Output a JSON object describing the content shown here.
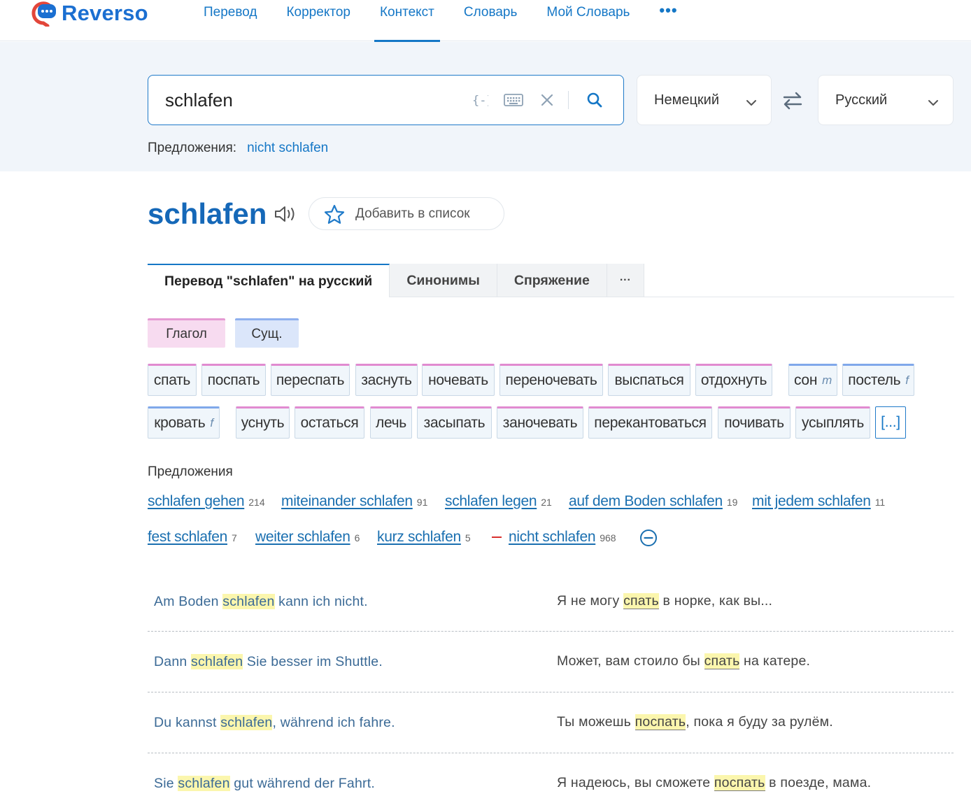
{
  "brand": {
    "name": "Reverso"
  },
  "nav": {
    "items": [
      {
        "label": "Перевод",
        "active": false
      },
      {
        "label": "Корректор",
        "active": false
      },
      {
        "label": "Контекст",
        "active": true
      },
      {
        "label": "Словарь",
        "active": false
      },
      {
        "label": "Мой Словарь",
        "active": false
      }
    ],
    "more": "•••"
  },
  "search": {
    "query": "schlafen",
    "source_lang": "Немецкий",
    "target_lang": "Русский",
    "suggestions_label": "Предложения:",
    "suggestion": "nicht schlafen"
  },
  "entry": {
    "headword": "schlafen",
    "add_to_list": "Добавить в список"
  },
  "tabs": [
    {
      "label": "Перевод \"schlafen\" на русский",
      "active": true
    },
    {
      "label": "Синонимы",
      "active": false
    },
    {
      "label": "Спряжение",
      "active": false
    },
    {
      "label": "···",
      "active": false
    }
  ],
  "pos": {
    "verb": "Глагол",
    "noun": "Сущ."
  },
  "translations": [
    {
      "text": "спать",
      "pos": "verb"
    },
    {
      "text": "поспать",
      "pos": "verb"
    },
    {
      "text": "переспать",
      "pos": "verb"
    },
    {
      "text": "заснуть",
      "pos": "verb"
    },
    {
      "text": "ночевать",
      "pos": "verb"
    },
    {
      "text": "переночевать",
      "pos": "verb"
    },
    {
      "text": "выспаться",
      "pos": "verb"
    },
    {
      "text": "отдохнуть",
      "pos": "verb"
    },
    {
      "text": "сон",
      "pos": "noun",
      "gender": "m"
    },
    {
      "text": "постель",
      "pos": "noun",
      "gender": "f"
    },
    {
      "text": "кровать",
      "pos": "noun",
      "gender": "f"
    },
    {
      "text": "уснуть",
      "pos": "verb"
    },
    {
      "text": "остаться",
      "pos": "verb"
    },
    {
      "text": "лечь",
      "pos": "verb"
    },
    {
      "text": "засыпать",
      "pos": "verb"
    },
    {
      "text": "заночевать",
      "pos": "verb"
    },
    {
      "text": "перекантоваться",
      "pos": "verb"
    },
    {
      "text": "почивать",
      "pos": "verb"
    },
    {
      "text": "усыплять",
      "pos": "verb"
    },
    {
      "text": "[...]",
      "pos": "more"
    }
  ],
  "phrases": {
    "title": "Предложения",
    "items": [
      {
        "text": "schlafen gehen",
        "count": "214"
      },
      {
        "text": "miteinander schlafen",
        "count": "91"
      },
      {
        "text": "schlafen legen",
        "count": "21"
      },
      {
        "text": "auf dem Boden schlafen",
        "count": "19"
      },
      {
        "text": "mit jedem schlafen",
        "count": "11"
      },
      {
        "text": "fest schlafen",
        "count": "7"
      },
      {
        "text": "weiter schlafen",
        "count": "6"
      },
      {
        "text": "kurz schlafen",
        "count": "5"
      },
      {
        "text": "nicht schlafen",
        "count": "968"
      }
    ]
  },
  "examples": [
    {
      "src_before": "Am Boden ",
      "src_hl": "schlafen",
      "src_after": " kann ich nicht.",
      "tgt_before": "Я не могу ",
      "tgt_hl": "спать",
      "tgt_after": " в норке, как вы..."
    },
    {
      "src_before": "Dann ",
      "src_hl": "schlafen",
      "src_after": " Sie besser im Shuttle.",
      "tgt_before": "Может, вам стоило бы ",
      "tgt_hl": "спать",
      "tgt_after": " на катере."
    },
    {
      "src_before": "Du kannst ",
      "src_hl": "schlafen",
      "src_after": ", während ich fahre.",
      "tgt_before": "Ты можешь ",
      "tgt_hl": "поспать",
      "tgt_after": ", пока я буду за рулём."
    },
    {
      "src_before": "Sie ",
      "src_hl": "schlafen",
      "src_after": " gut während der Fahrt.",
      "tgt_before": "Я надеюсь, вы сможете ",
      "tgt_hl": "поспать",
      "tgt_after": " в поезде, мама."
    }
  ],
  "icons": {
    "logo": "reverso-logo-icon",
    "context_braces": "braces-icon",
    "keyboard": "keyboard-icon",
    "clear": "close-icon",
    "search": "search-icon",
    "chevron": "chevron-down-icon",
    "swap": "swap-icon",
    "speaker": "speaker-icon",
    "star": "star-icon",
    "collapse": "minus-circle-icon"
  },
  "colors": {
    "brand_blue": "#1b6fd1",
    "logo_red": "#e2463a",
    "link_blue": "#1577c6",
    "verb_accent": "#e18bd0",
    "noun_accent": "#80a8ea",
    "highlight": "#fbf6ad"
  }
}
